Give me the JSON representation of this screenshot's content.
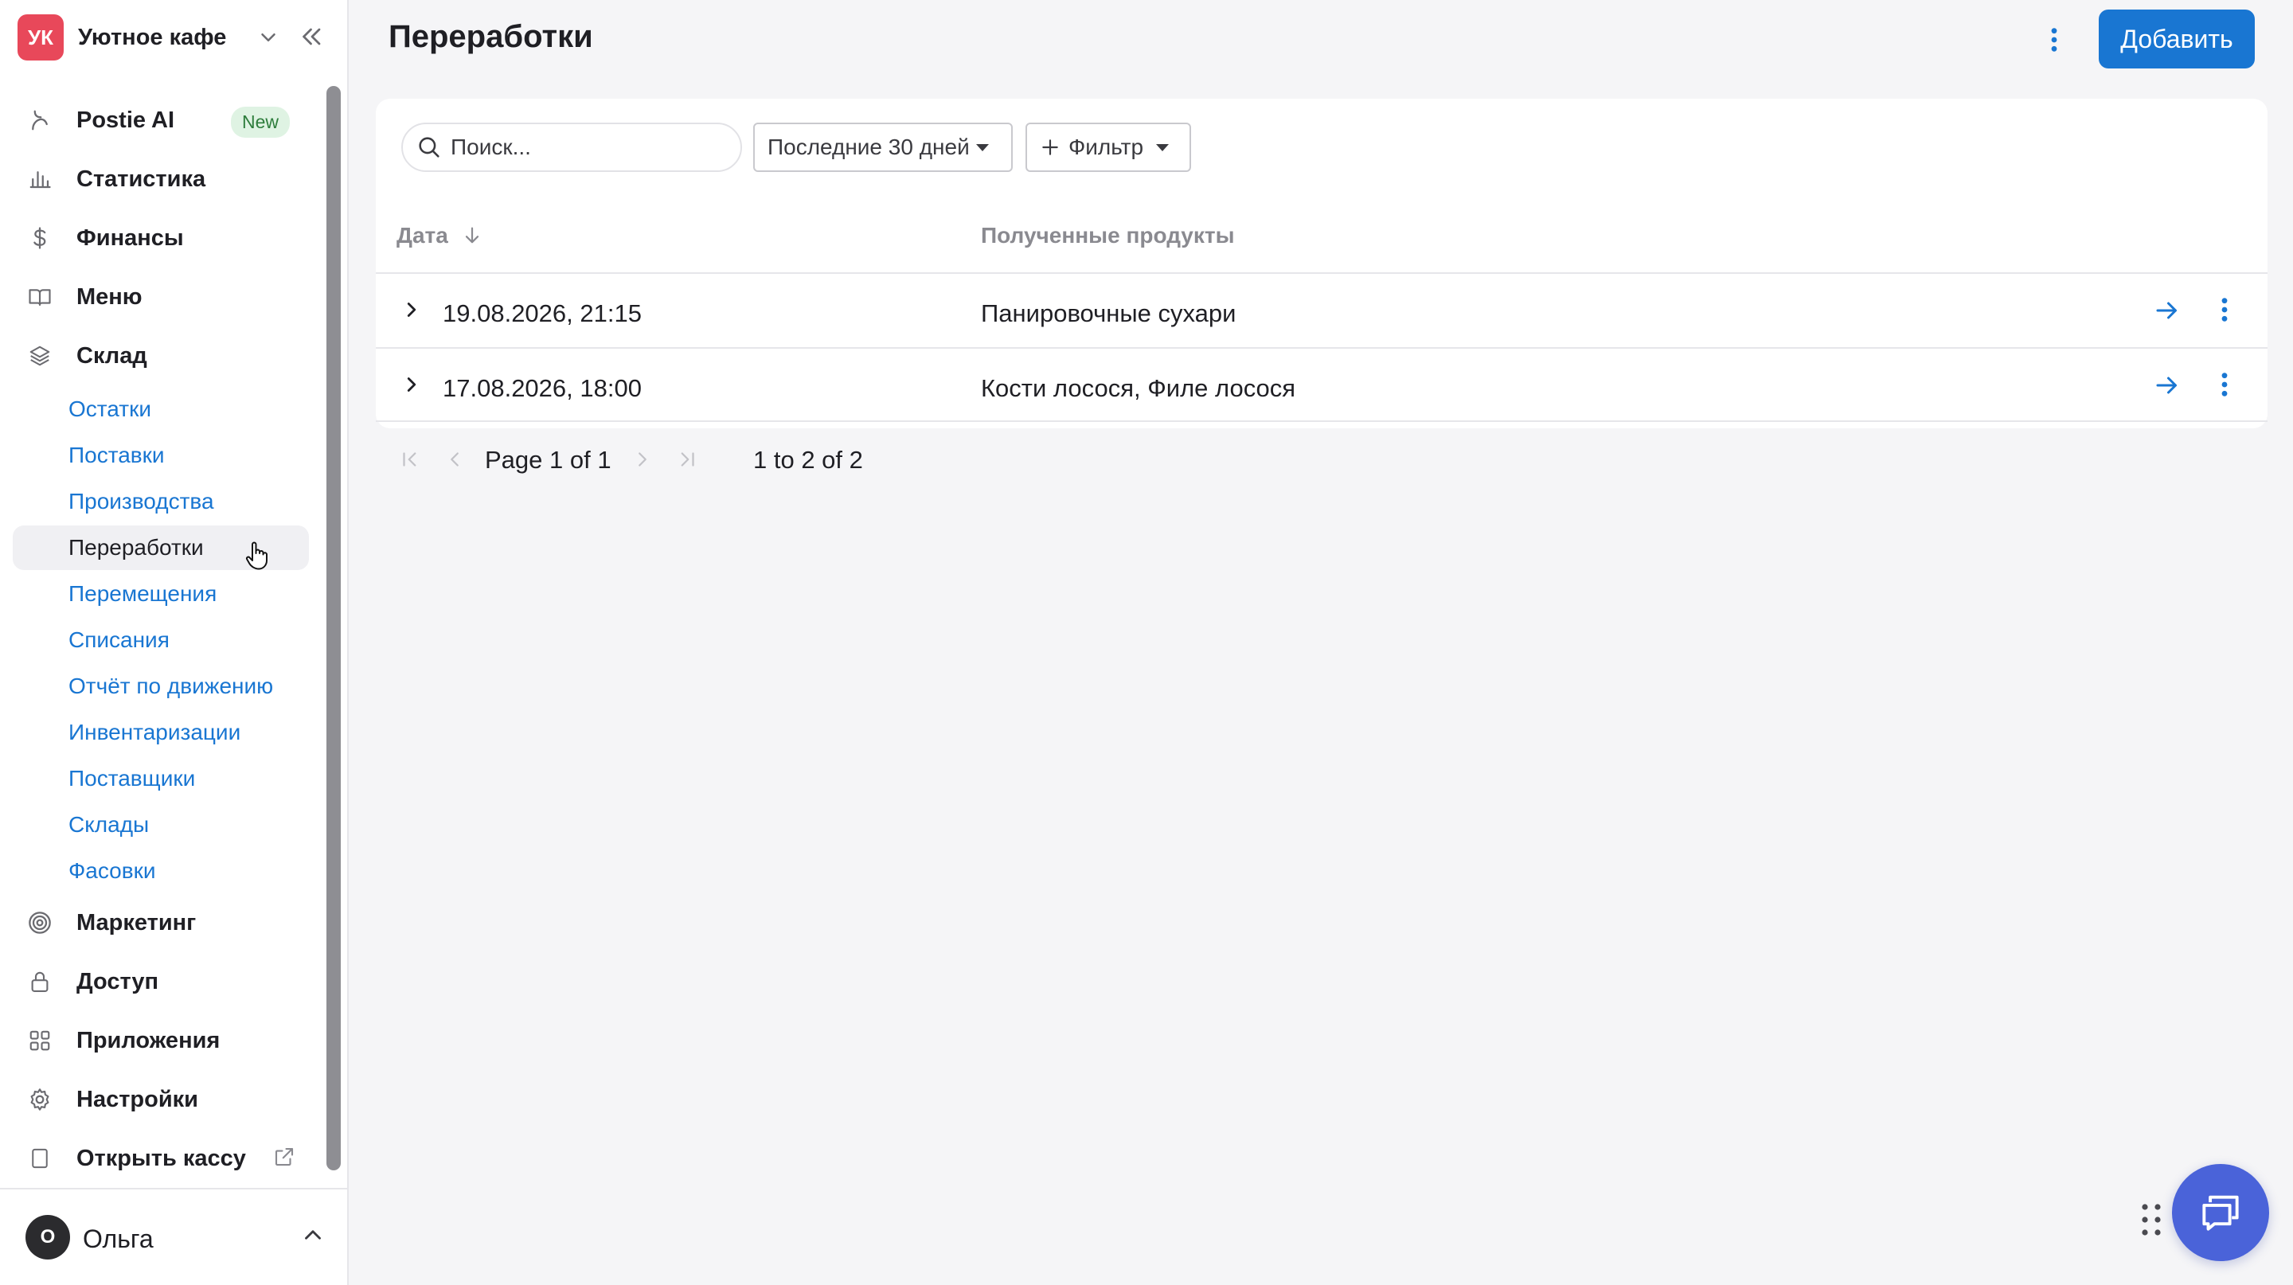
{
  "org": {
    "initials": "УК",
    "name": "Уютное кафе"
  },
  "nav": {
    "postie": {
      "label": "Postie AI",
      "badge": "New"
    },
    "stats": {
      "label": "Статистика"
    },
    "finance": {
      "label": "Финансы"
    },
    "menu": {
      "label": "Меню"
    },
    "warehouse": {
      "label": "Склад",
      "sub": [
        {
          "label": "Остатки"
        },
        {
          "label": "Поставки"
        },
        {
          "label": "Производства"
        },
        {
          "label": "Переработки",
          "active": true
        },
        {
          "label": "Перемещения"
        },
        {
          "label": "Списания"
        },
        {
          "label": "Отчёт по движению"
        },
        {
          "label": "Инвентаризации"
        },
        {
          "label": "Поставщики"
        },
        {
          "label": "Склады"
        },
        {
          "label": "Фасовки"
        }
      ]
    },
    "marketing": {
      "label": "Маркетинг"
    },
    "access": {
      "label": "Доступ"
    },
    "apps": {
      "label": "Приложения"
    },
    "settings": {
      "label": "Настройки"
    },
    "pos": {
      "label": "Открыть кассу"
    }
  },
  "user": {
    "initial": "О",
    "name": "Ольга"
  },
  "page": {
    "title": "Переработки",
    "add_label": "Добавить"
  },
  "toolbar": {
    "search_placeholder": "Поиск...",
    "period_label": "Последние 30 дней",
    "filter_label": "Фильтр"
  },
  "table": {
    "headers": {
      "date": "Дата",
      "products": "Полученные продукты"
    },
    "rows": [
      {
        "date": "19.08.2026, 21:15",
        "products": "Панировочные сухари"
      },
      {
        "date": "17.08.2026, 18:00",
        "products": "Кости лосося, Филе лосося"
      }
    ]
  },
  "pagination": {
    "page_text": "Page 1 of 1",
    "range_text": "1 to 2 of 2"
  },
  "colors": {
    "accent": "#1976d2",
    "org_avatar": "#e8485a",
    "chat": "#4a63d9",
    "badge_bg": "#dff3e3"
  }
}
